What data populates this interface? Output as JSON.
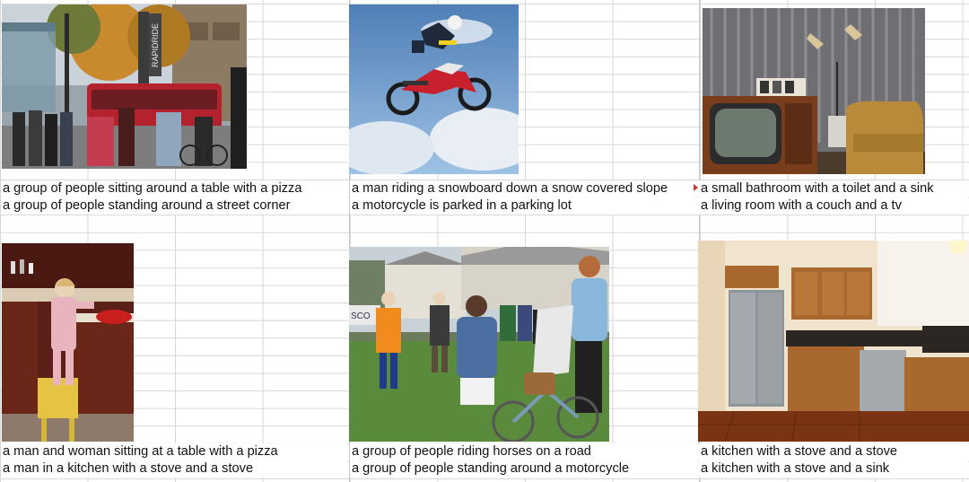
{
  "cells": [
    {
      "caption_1": "a group of people sitting around a table with a pizza",
      "caption_2": "a group of people standing around a street corner",
      "sign_text": "RAPIDRIDE"
    },
    {
      "caption_1": "a man riding a snowboard down a snow covered slope",
      "caption_2": "a motorcycle is parked in a parking lot"
    },
    {
      "caption_1": "a small bathroom with a toilet and a sink",
      "caption_2": "a living room with a couch and a tv"
    },
    {
      "caption_1": "a man and woman sitting at a table with a pizza",
      "caption_2": "a man in a kitchen with a stove and a stove"
    },
    {
      "caption_1": "a group of people riding horses on a road",
      "caption_2": "a group of people standing around a motorcycle",
      "sign_text": "SCO"
    },
    {
      "caption_1": "a kitchen with a stove and a stove",
      "caption_2": "a kitchen with a stove and a sink"
    }
  ],
  "colors": {
    "grid": "#d7d7d7",
    "comment_marker": "#d0302a"
  }
}
